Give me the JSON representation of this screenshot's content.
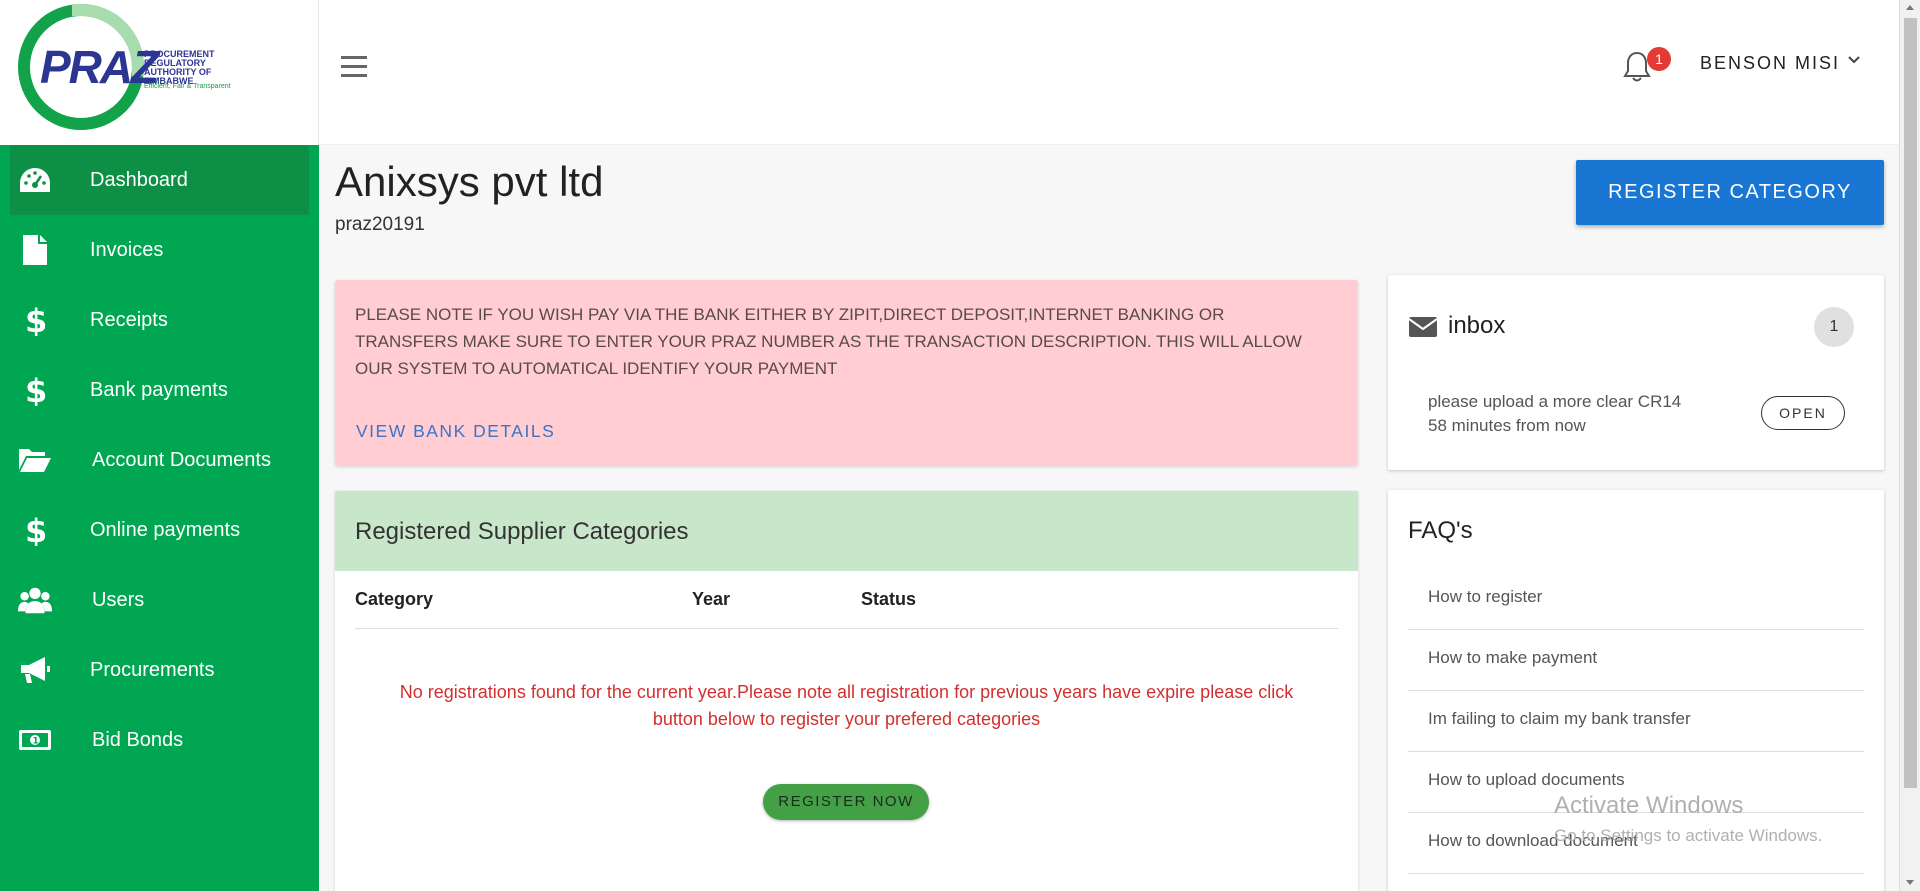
{
  "brand": {
    "logo_text": "PRAZ",
    "logo_subtitle": "PROCUREMENT REGULATORY AUTHORITY OF ZIMBABWE",
    "logo_tagline": "Efficient, Fair & Transparent",
    "primary_color": "#00a651"
  },
  "sidebar": {
    "items": [
      {
        "label": "Dashboard",
        "icon": "dashboard-icon",
        "active": true
      },
      {
        "label": "Invoices",
        "icon": "file-icon"
      },
      {
        "label": "Receipts",
        "icon": "dollar-icon"
      },
      {
        "label": "Bank payments",
        "icon": "dollar-icon"
      },
      {
        "label": "Account Documents",
        "icon": "folder-open-icon"
      },
      {
        "label": "Online payments",
        "icon": "dollar-icon"
      },
      {
        "label": "Users",
        "icon": "users-icon"
      },
      {
        "label": "Procurements",
        "icon": "megaphone-icon"
      },
      {
        "label": "Bid Bonds",
        "icon": "money-icon"
      }
    ]
  },
  "topbar": {
    "notification_count": "1",
    "user_name": "BENSON MISI"
  },
  "header": {
    "company_name": "Anixsys pvt ltd",
    "company_id": "praz20191",
    "register_category_label": "REGISTER CATEGORY"
  },
  "alert": {
    "message": "PLEASE NOTE IF YOU WISH PAY VIA THE BANK EITHER BY ZIPIT,DIRECT DEPOSIT,INTERNET BANKING OR TRANSFERS MAKE SURE TO ENTER YOUR PRAZ NUMBER AS THE TRANSACTION DESCRIPTION. THIS WILL ALLOW OUR SYSTEM TO AUTOMATICAL IDENTIFY YOUR PAYMENT",
    "link_label": "VIEW BANK DETAILS"
  },
  "categories": {
    "title": "Registered Supplier Categories",
    "columns": [
      "Category",
      "Year",
      "Status"
    ],
    "empty_message": "No registrations found for the current year.Please note all registration for previous years have expire please click button below to register your prefered categories",
    "register_now_label": "REGISTER NOW"
  },
  "inbox": {
    "title": "inbox",
    "count": "1",
    "messages": [
      {
        "text": "please upload a more clear CR14",
        "time": "58 minutes from now",
        "action": "OPEN"
      }
    ]
  },
  "faq": {
    "title": "FAQ's",
    "items": [
      "How to register",
      "How to make payment",
      "Im failing to claim my bank transfer",
      "How to upload documents",
      "How to download document"
    ]
  },
  "watermark": {
    "line1": "Activate Windows",
    "line2": "Go to Settings to activate Windows."
  }
}
